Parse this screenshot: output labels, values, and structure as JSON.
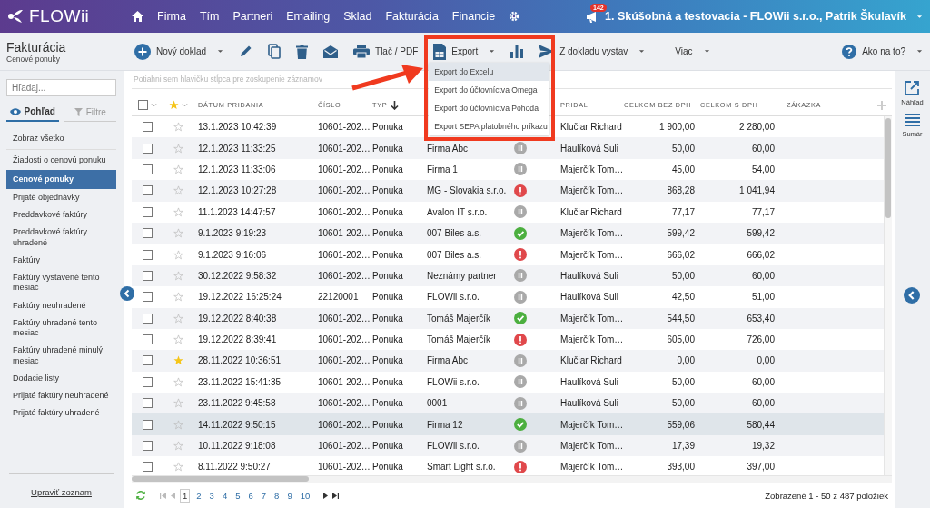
{
  "topbar": {
    "logo": "FLOWii",
    "nav": [
      {
        "label": "Firma"
      },
      {
        "label": "Tím"
      },
      {
        "label": "Partneri"
      },
      {
        "label": "Emailing"
      },
      {
        "label": "Sklad"
      },
      {
        "label": "Fakturácia"
      },
      {
        "label": "Financie"
      }
    ],
    "notification_count": "142",
    "account": "1. Skúšobná a testovacia - FLOWii s.r.o., Patrik Škulavík"
  },
  "page": {
    "title": "Fakturácia",
    "subtitle": "Cenové ponuky"
  },
  "toolbar": [
    {
      "kind": "labeled",
      "label": "Nový doklad",
      "dropdown": true
    },
    {
      "kind": "icon"
    },
    {
      "kind": "icon"
    },
    {
      "kind": "icon"
    },
    {
      "kind": "icon"
    },
    {
      "kind": "labeled",
      "label": "Tlač / PDF",
      "dropdown": false
    },
    {
      "kind": "labeled",
      "label": "Export",
      "dropdown": true,
      "expanded": true,
      "menu": [
        {
          "label": "Export do Excelu",
          "selected": true
        },
        {
          "label": "Export do účtovníctva Omega",
          "selected": false
        },
        {
          "label": "Export do účtovníctva Pohoda",
          "selected": false
        },
        {
          "label": "Export SEPA platobného príkazu",
          "selected": false
        }
      ]
    },
    {
      "kind": "icon"
    },
    {
      "kind": "labeled",
      "label": "Z dokladu vystav",
      "dropdown": true
    },
    {
      "kind": "text",
      "label": "Viac",
      "dropdown": true
    }
  ],
  "help": {
    "label": "Ako na to?",
    "dropdown": true
  },
  "sidebar": {
    "search_placeholder": "Hľadaj...",
    "tabs": [
      {
        "label": "Pohľad",
        "selected": true
      },
      {
        "label": "Filtre",
        "selected": false
      }
    ],
    "items": [
      {
        "label": "Zobraz všetko",
        "selected": false
      },
      {
        "label": "Žiadosti o cenovú ponuku",
        "selected": false
      },
      {
        "label": "Cenové ponuky",
        "selected": true
      },
      {
        "label": "Prijaté objednávky",
        "selected": false
      },
      {
        "label": "Preddavkové faktúry",
        "selected": false
      },
      {
        "label": "Preddavkové faktúry uhradené",
        "selected": false
      },
      {
        "label": "Faktúry",
        "selected": false
      },
      {
        "label": "Faktúry vystavené tento mesiac",
        "selected": false
      },
      {
        "label": "Faktúry neuhradené",
        "selected": false
      },
      {
        "label": "Faktúry uhradené tento mesiac",
        "selected": false
      },
      {
        "label": "Faktúry uhradené minulý mesiac",
        "selected": false
      },
      {
        "label": "Dodacie listy",
        "selected": false
      },
      {
        "label": "Prijaté faktúry neuhradené",
        "selected": false
      },
      {
        "label": "Prijaté faktúry uhradené",
        "selected": false
      }
    ],
    "footer_link": "Upraviť zoznam"
  },
  "table": {
    "group_hint": "Potiahni sem hlavičku stĺpca pre zoskupenie záznamov",
    "columns": [
      {
        "label": "DÁTUM PRIDANIA"
      },
      {
        "label": "ČÍSLO"
      },
      {
        "label": "TYP",
        "sorted": true
      },
      {},
      {},
      {
        "label": "PRIDAL"
      },
      {
        "label": "CELKOM BEZ DPH"
      },
      {
        "label": "CELKOM S DPH"
      },
      {
        "label": "ZÁKAZKA"
      }
    ],
    "all_checked": false,
    "rows": [
      {
        "date": "13.1.2023 10:42:39",
        "number": "10601-202…",
        "type": "Ponuka",
        "author": "Klučiar Richard",
        "net": "1 900,00",
        "gross": "2 280,00",
        "starred": false,
        "checked": false,
        "selected": false
      },
      {
        "date": "12.1.2023 11:33:25",
        "number": "10601-202…",
        "type": "Ponuka",
        "partner": "Firma Abc",
        "status": {
          "kind": "pending",
          "color": "#a9a9a9"
        },
        "author": "Haulíková Suli",
        "net": "50,00",
        "gross": "60,00",
        "starred": false,
        "checked": false,
        "selected": false
      },
      {
        "date": "12.1.2023 11:33:06",
        "number": "10601-202…",
        "type": "Ponuka",
        "partner": "Firma 1",
        "status": {
          "kind": "pending",
          "color": "#a9a9a9"
        },
        "author": "Majerčík Tom…",
        "net": "45,00",
        "gross": "54,00",
        "starred": false,
        "checked": false,
        "selected": false
      },
      {
        "date": "12.1.2023 10:27:28",
        "number": "10601-202…",
        "type": "Ponuka",
        "partner": "MG - Slovakia s.r.o.",
        "status": {
          "kind": "warning",
          "color": "#e0484b"
        },
        "author": "Majerčík Tom…",
        "net": "868,28",
        "gross": "1 041,94",
        "starred": false,
        "checked": false,
        "selected": false
      },
      {
        "date": "11.1.2023 14:47:57",
        "number": "10601-202…",
        "type": "Ponuka",
        "partner": "Avalon IT s.r.o.",
        "status": {
          "kind": "pending",
          "color": "#a9a9a9"
        },
        "author": "Klučiar Richard",
        "net": "77,17",
        "gross": "77,17",
        "starred": false,
        "checked": false,
        "selected": false
      },
      {
        "date": "9.1.2023 9:19:23",
        "number": "10601-202…",
        "type": "Ponuka",
        "partner": "007 Biles a.s.",
        "status": {
          "kind": "done",
          "color": "#4caf3f"
        },
        "author": "Majerčík Tom…",
        "net": "599,42",
        "gross": "599,42",
        "starred": false,
        "checked": false,
        "selected": false
      },
      {
        "date": "9.1.2023 9:16:06",
        "number": "10601-202…",
        "type": "Ponuka",
        "partner": "007 Biles a.s.",
        "status": {
          "kind": "warning",
          "color": "#e0484b"
        },
        "author": "Majerčík Tom…",
        "net": "666,02",
        "gross": "666,02",
        "starred": false,
        "checked": false,
        "selected": false
      },
      {
        "date": "30.12.2022 9:58:32",
        "number": "10601-202…",
        "type": "Ponuka",
        "partner": "Neznámy partner",
        "status": {
          "kind": "pending",
          "color": "#a9a9a9"
        },
        "author": "Haulíková Suli",
        "net": "50,00",
        "gross": "60,00",
        "starred": false,
        "checked": false,
        "selected": false
      },
      {
        "date": "19.12.2022 16:25:24",
        "number": "22120001",
        "type": "Ponuka",
        "partner": "FLOWii s.r.o.",
        "status": {
          "kind": "pending",
          "color": "#a9a9a9"
        },
        "author": "Haulíková Suli",
        "net": "42,50",
        "gross": "51,00",
        "starred": false,
        "checked": false,
        "selected": false
      },
      {
        "date": "19.12.2022 8:40:38",
        "number": "10601-202…",
        "type": "Ponuka",
        "partner": "Tomáš Majerčík",
        "status": {
          "kind": "done",
          "color": "#4caf3f"
        },
        "author": "Majerčík Tom…",
        "net": "544,50",
        "gross": "653,40",
        "starred": false,
        "checked": false,
        "selected": false
      },
      {
        "date": "19.12.2022 8:39:41",
        "number": "10601-202…",
        "type": "Ponuka",
        "partner": "Tomáš Majerčík",
        "status": {
          "kind": "warning",
          "color": "#e0484b"
        },
        "author": "Majerčík Tom…",
        "net": "605,00",
        "gross": "726,00",
        "starred": false,
        "checked": false,
        "selected": false
      },
      {
        "date": "28.11.2022 10:36:51",
        "number": "10601-202…",
        "type": "Ponuka",
        "partner": "Firma Abc",
        "status": {
          "kind": "pending",
          "color": "#a9a9a9"
        },
        "author": "Klučiar Richard",
        "net": "0,00",
        "gross": "0,00",
        "starred": true,
        "checked": false,
        "selected": false
      },
      {
        "date": "23.11.2022 15:41:35",
        "number": "10601-202…",
        "type": "Ponuka",
        "partner": "FLOWii s.r.o.",
        "status": {
          "kind": "pending",
          "color": "#a9a9a9"
        },
        "author": "Haulíková Suli",
        "net": "50,00",
        "gross": "60,00",
        "starred": false,
        "checked": false,
        "selected": false
      },
      {
        "date": "23.11.2022 9:45:58",
        "number": "10601-202…",
        "type": "Ponuka",
        "partner": "0001",
        "status": {
          "kind": "pending",
          "color": "#a9a9a9"
        },
        "author": "Haulíková Suli",
        "net": "50,00",
        "gross": "60,00",
        "starred": false,
        "checked": false,
        "selected": false
      },
      {
        "date": "14.11.2022 9:50:15",
        "number": "10601-202…",
        "type": "Ponuka",
        "partner": "Firma 12",
        "status": {
          "kind": "done",
          "color": "#4caf3f"
        },
        "author": "Majerčík Tom…",
        "net": "559,06",
        "gross": "580,44",
        "starred": false,
        "checked": false,
        "selected": true
      },
      {
        "date": "10.11.2022 9:18:08",
        "number": "10601-202…",
        "type": "Ponuka",
        "partner": "FLOWii s.r.o.",
        "status": {
          "kind": "pending",
          "color": "#a9a9a9"
        },
        "author": "Majerčík Tom…",
        "net": "17,39",
        "gross": "19,32",
        "starred": false,
        "checked": false,
        "selected": false
      },
      {
        "date": "8.11.2022 9:50:27",
        "number": "10601-202…",
        "type": "Ponuka",
        "partner": "Smart Light s.r.o.",
        "status": {
          "kind": "warning",
          "color": "#e0484b"
        },
        "author": "Majerčík Tom…",
        "net": "393,00",
        "gross": "397,00",
        "starred": false,
        "checked": false,
        "selected": false
      }
    ],
    "pages": [
      {
        "label": "1",
        "selected": true
      },
      {
        "label": "2",
        "selected": false
      },
      {
        "label": "3",
        "selected": false
      },
      {
        "label": "4",
        "selected": false
      },
      {
        "label": "5",
        "selected": false
      },
      {
        "label": "6",
        "selected": false
      },
      {
        "label": "7",
        "selected": false
      },
      {
        "label": "8",
        "selected": false
      },
      {
        "label": "9",
        "selected": false
      },
      {
        "label": "10",
        "selected": false
      }
    ],
    "summary": "Zobrazené 1 - 50 z 487 položiek"
  },
  "right_rail": [
    {
      "label": "Náhľad"
    },
    {
      "label": "Sumár"
    }
  ]
}
